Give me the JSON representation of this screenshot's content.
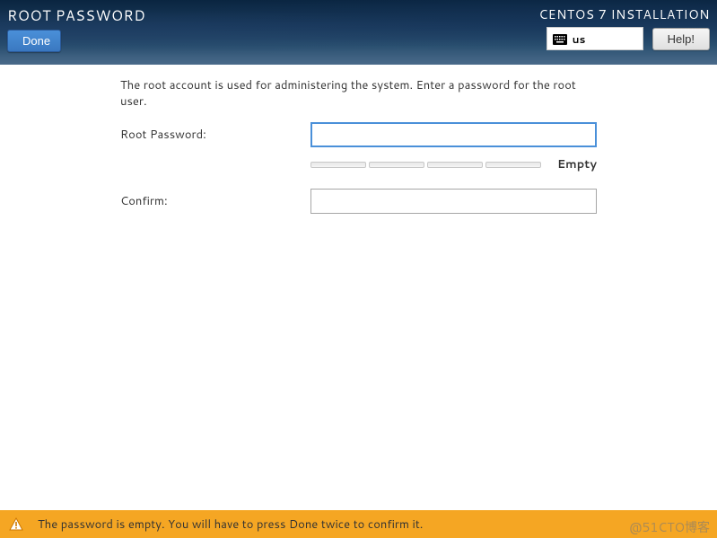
{
  "header": {
    "title": "ROOT PASSWORD",
    "subtitle": "CENTOS 7 INSTALLATION",
    "done_label": "Done",
    "help_label": "Help!",
    "lang_code": "us"
  },
  "form": {
    "description": "The root account is used for administering the system.  Enter a password for the root user.",
    "password_label": "Root Password:",
    "password_value": "",
    "confirm_label": "Confirm:",
    "confirm_value": "",
    "strength_label": "Empty"
  },
  "warning": {
    "message": "The password is empty. You will have to press Done twice to confirm it."
  },
  "watermark": "@51CTO博客"
}
